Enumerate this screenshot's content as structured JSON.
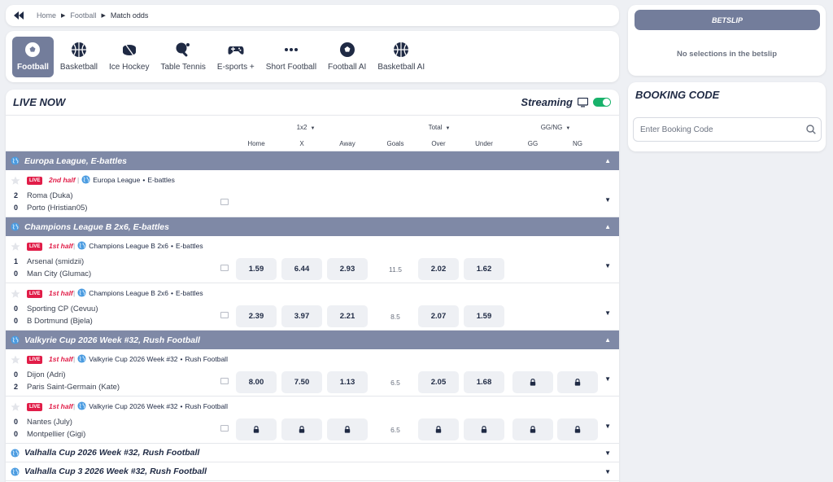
{
  "breadcrumb": {
    "items": [
      "Home",
      "Football",
      "Match odds"
    ]
  },
  "sports": [
    {
      "label": "Football",
      "icon": "football-icon",
      "active": true
    },
    {
      "label": "Basketball",
      "icon": "basketball-icon"
    },
    {
      "label": "Ice Hockey",
      "icon": "hockey-puck-icon"
    },
    {
      "label": "Table Tennis",
      "icon": "table-tennis-icon"
    },
    {
      "label": "E-sports +",
      "icon": "gamepad-icon"
    },
    {
      "label": "Short Football",
      "icon": "more-dots-icon"
    },
    {
      "label": "Football AI",
      "icon": "football-icon"
    },
    {
      "label": "Basketball AI",
      "icon": "basketball-icon"
    }
  ],
  "live": {
    "title": "LIVE NOW",
    "streaming_label": "Streaming"
  },
  "markets": {
    "groups": [
      "1x2",
      "Total",
      "GG/NG"
    ],
    "columns": [
      "Home",
      "X",
      "Away",
      "Goals",
      "Over",
      "Under",
      "GG",
      "NG"
    ]
  },
  "sections": [
    {
      "league": "Europa League, E-battles",
      "matches": [
        {
          "half": "2nd half",
          "competition": "Europa League",
          "category": "E-battles",
          "home": {
            "score": "2",
            "name": "Roma (Duka)"
          },
          "away": {
            "score": "0",
            "name": "Porto (Hristian05)"
          },
          "odds": []
        }
      ]
    },
    {
      "league": "Champions League B 2x6, E-battles",
      "matches": [
        {
          "half": "1st half",
          "competition": "Champions League B 2x6",
          "category": "E-battles",
          "home": {
            "score": "1",
            "name": "Arsenal (smidzii)"
          },
          "away": {
            "score": "0",
            "name": "Man City (Glumac)"
          },
          "odds": [
            "1.59",
            "6.44",
            "2.93"
          ],
          "goals": "11.5",
          "total": [
            "2.02",
            "1.62"
          ]
        },
        {
          "half": "1st half",
          "competition": "Champions League B 2x6",
          "category": "E-battles",
          "home": {
            "score": "0",
            "name": "Sporting CP (Cevuu)"
          },
          "away": {
            "score": "0",
            "name": "B Dortmund (Bjela)"
          },
          "odds": [
            "2.39",
            "3.97",
            "2.21"
          ],
          "goals": "8.5",
          "total": [
            "2.07",
            "1.59"
          ]
        }
      ]
    },
    {
      "league": "Valkyrie Cup 2026 Week #32, Rush Football",
      "matches": [
        {
          "half": "1st half",
          "competition": "Valkyrie Cup 2026 Week #32",
          "category": "Rush Football",
          "home": {
            "score": "0",
            "name": "Dijon (Adri)"
          },
          "away": {
            "score": "2",
            "name": "Paris Saint-Germain (Kate)"
          },
          "odds": [
            "8.00",
            "7.50",
            "1.13"
          ],
          "goals": "6.5",
          "total": [
            "2.05",
            "1.68"
          ],
          "ggng_locked": true
        },
        {
          "half": "1st half",
          "competition": "Valkyrie Cup 2026 Week #32",
          "category": "Rush Football",
          "home": {
            "score": "0",
            "name": "Nantes (July)"
          },
          "away": {
            "score": "0",
            "name": "Montpellier (Gigi)"
          },
          "odds_locked": true,
          "goals": "6.5",
          "total_locked": true,
          "ggng_locked": true
        }
      ]
    }
  ],
  "collapsed_leagues": [
    "Valhalla Cup 2026 Week #32, Rush Football",
    "Valhalla Cup 3 2026 Week #32, Rush Football"
  ],
  "live_badge": "LIVE",
  "betslip": {
    "title": "BETSLIP",
    "empty": "No selections in the betslip"
  },
  "booking": {
    "title": "BOOKING CODE",
    "placeholder": "Enter Booking Code"
  },
  "colors": {
    "accent": "#737d9b",
    "league_bar": "#7f89a6",
    "live": "#e11d48",
    "toggle_on": "#19b26b"
  }
}
